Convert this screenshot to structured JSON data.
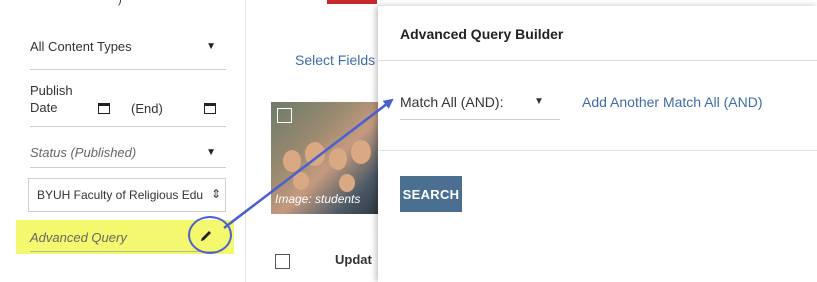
{
  "sidebar": {
    "content_type": "All Content Types",
    "publish_date_label": "Publish Date",
    "end_label": "(End)",
    "status_placeholder": "Status (Published)",
    "organization": "BYUH Faculty of Religious Edu",
    "advanced_query": "Advanced Query"
  },
  "main": {
    "select_fields": "Select Fields",
    "image_caption": "Image: students",
    "column_updated": "Updat"
  },
  "panel": {
    "title": "Advanced Query Builder",
    "match_value": "Match All (AND):",
    "add_match": "Add Another Match All (AND)",
    "search_button": "SEARCH"
  },
  "colors": {
    "highlight": "#f4f86e",
    "annotation": "#4a5fd1",
    "link": "#3d6da8",
    "button": "#4b6f91",
    "active_tab": "#c7282d"
  },
  "icons": [
    "chevron-down-icon",
    "calendar-icon",
    "pencil-icon",
    "checkbox-icon"
  ]
}
